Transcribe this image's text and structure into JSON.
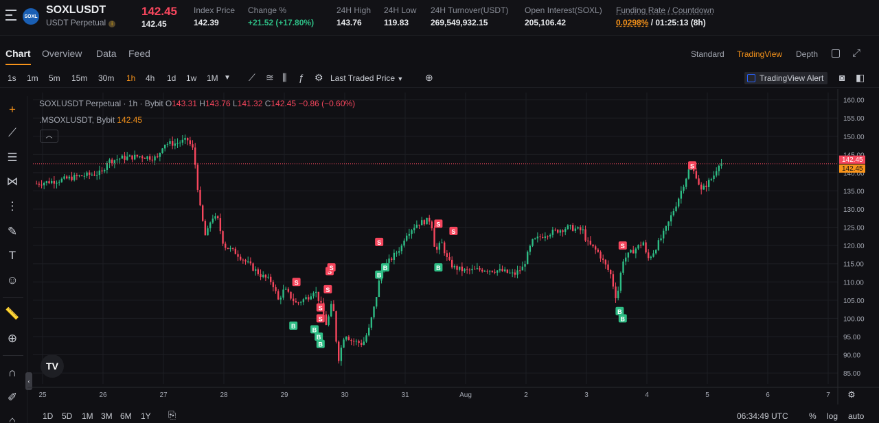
{
  "header": {
    "logo_text": "SOXL",
    "symbol": "SOXLUSDT",
    "contract_type": "USDT Perpetual",
    "last_price": "142.45",
    "mark_price": "142.45",
    "stats": [
      {
        "label": "Index Price",
        "value": "142.39"
      },
      {
        "label": "Change %",
        "value": "+21.52 (+17.80%)"
      },
      {
        "label": "24H High",
        "value": "143.76"
      },
      {
        "label": "24H Low",
        "value": "119.83"
      },
      {
        "label": "24H Turnover(USDT)",
        "value": "269,549,932.15"
      },
      {
        "label": "Open Interest(SOXL)",
        "value": "205,106.42"
      }
    ],
    "funding": {
      "label": "Funding Rate / Countdown",
      "rate": "0.0298%",
      "countdown": " / 01:25:13 (8h)"
    }
  },
  "tabs": [
    "Chart",
    "Overview",
    "Data",
    "Feed"
  ],
  "views": [
    "Standard",
    "TradingView",
    "Depth"
  ],
  "timeframes": [
    "1s",
    "1m",
    "5m",
    "15m",
    "30m",
    "1h",
    "4h",
    "1d",
    "1w",
    "1M"
  ],
  "active_timeframe": "1h",
  "price_source": "Last Traded Price",
  "tv_alert": "TradingView Alert",
  "legend": {
    "title": "SOXLUSDT Perpetual · 1h · Bybit",
    "o_label": "O",
    "o": "143.31",
    "h_label": "H",
    "h": "143.76",
    "l_label": "L",
    "l": "141.32",
    "c_label": "C",
    "c": "142.45",
    "change": "−0.86 (−0.60%)",
    "index_name": ".MSOXLUSDT, Bybit",
    "index_value": "142.45"
  },
  "tv_logo": "TV",
  "chart_data": {
    "type": "candlestick",
    "y_ticks": [
      "160.00",
      "155.00",
      "150.00",
      "145.00",
      "140.00",
      "135.00",
      "130.00",
      "125.00",
      "120.00",
      "115.00",
      "110.00",
      "105.00",
      "100.00",
      "95.00",
      "90.00",
      "85.00"
    ],
    "x_ticks": [
      "25",
      "26",
      "27",
      "28",
      "29",
      "30",
      "31",
      "Aug",
      "2",
      "3",
      "4",
      "5",
      "6",
      "7"
    ],
    "ylim": [
      82,
      162
    ],
    "last_price_label": "142.45",
    "index_price_label": "142.45",
    "close_path": [
      [
        24.9,
        137
      ],
      [
        25.3,
        138
      ],
      [
        25.6,
        139
      ],
      [
        25.8,
        139.5
      ],
      [
        26.0,
        140
      ],
      [
        26.05,
        143
      ],
      [
        26.3,
        144
      ],
      [
        26.6,
        144.5
      ],
      [
        26.9,
        144
      ],
      [
        27.0,
        148
      ],
      [
        27.2,
        148
      ],
      [
        27.4,
        149
      ],
      [
        27.5,
        146
      ],
      [
        27.6,
        131
      ],
      [
        27.7,
        122
      ],
      [
        27.8,
        128
      ],
      [
        27.9,
        127
      ],
      [
        28.0,
        120
      ],
      [
        28.2,
        118
      ],
      [
        28.4,
        115
      ],
      [
        28.6,
        112
      ],
      [
        28.8,
        110
      ],
      [
        28.9,
        105
      ],
      [
        29.0,
        108
      ],
      [
        29.2,
        104
      ],
      [
        29.4,
        106
      ],
      [
        29.5,
        108
      ],
      [
        29.6,
        104
      ],
      [
        29.7,
        98
      ],
      [
        29.8,
        105
      ],
      [
        29.85,
        95
      ],
      [
        29.9,
        89
      ],
      [
        30.0,
        96
      ],
      [
        30.1,
        94
      ],
      [
        30.3,
        93
      ],
      [
        30.4,
        97
      ],
      [
        30.5,
        104
      ],
      [
        30.6,
        113
      ],
      [
        30.8,
        117
      ],
      [
        30.95,
        120
      ],
      [
        31.0,
        123
      ],
      [
        31.2,
        126
      ],
      [
        31.4,
        127
      ],
      [
        31.45,
        125
      ],
      [
        31.5,
        118
      ],
      [
        31.6,
        121
      ],
      [
        31.7,
        116
      ],
      [
        31.8,
        114
      ],
      [
        32.0,
        113
      ],
      [
        32.3,
        113.5
      ],
      [
        32.6,
        113
      ],
      [
        32.8,
        112
      ],
      [
        32.95,
        114
      ],
      [
        33.1,
        121
      ],
      [
        33.3,
        123
      ],
      [
        33.5,
        124
      ],
      [
        33.7,
        125
      ],
      [
        33.95,
        124
      ],
      [
        34.0,
        121
      ],
      [
        34.2,
        118
      ],
      [
        34.4,
        112
      ],
      [
        34.5,
        105
      ],
      [
        34.6,
        116
      ],
      [
        34.8,
        119
      ],
      [
        34.95,
        121
      ],
      [
        35.0,
        116
      ],
      [
        35.1,
        118
      ],
      [
        35.3,
        124
      ],
      [
        35.5,
        132
      ],
      [
        35.7,
        141
      ],
      [
        35.8,
        140
      ],
      [
        35.9,
        135
      ],
      [
        36.0,
        137
      ],
      [
        36.1,
        139
      ],
      [
        36.2,
        143
      ],
      [
        36.25,
        142.45
      ]
    ],
    "markers": [
      {
        "t": "S",
        "d": 29.2,
        "v": 110
      },
      {
        "t": "B",
        "d": 29.15,
        "v": 98
      },
      {
        "t": "S",
        "d": 29.72,
        "v": 108
      },
      {
        "t": "S",
        "d": 29.75,
        "v": 113
      },
      {
        "t": "S",
        "d": 29.78,
        "v": 114
      },
      {
        "t": "S",
        "d": 29.6,
        "v": 103
      },
      {
        "t": "S",
        "d": 29.6,
        "v": 100
      },
      {
        "t": "B",
        "d": 29.5,
        "v": 97
      },
      {
        "t": "B",
        "d": 29.57,
        "v": 95
      },
      {
        "t": "B",
        "d": 29.6,
        "v": 93
      },
      {
        "t": "S",
        "d": 30.57,
        "v": 121
      },
      {
        "t": "B",
        "d": 30.57,
        "v": 112
      },
      {
        "t": "B",
        "d": 30.67,
        "v": 114
      },
      {
        "t": "S",
        "d": 31.55,
        "v": 126
      },
      {
        "t": "S",
        "d": 31.8,
        "v": 124
      },
      {
        "t": "B",
        "d": 31.55,
        "v": 114
      },
      {
        "t": "S",
        "d": 34.6,
        "v": 120
      },
      {
        "t": "B",
        "d": 34.55,
        "v": 102
      },
      {
        "t": "B",
        "d": 34.6,
        "v": 100
      },
      {
        "t": "S",
        "d": 35.75,
        "v": 142
      }
    ]
  },
  "ranges": [
    "1D",
    "5D",
    "1M",
    "3M",
    "6M",
    "1Y"
  ],
  "bottom": {
    "time": "06:34:49 UTC",
    "percent": "%",
    "log": "log",
    "auto": "auto"
  }
}
